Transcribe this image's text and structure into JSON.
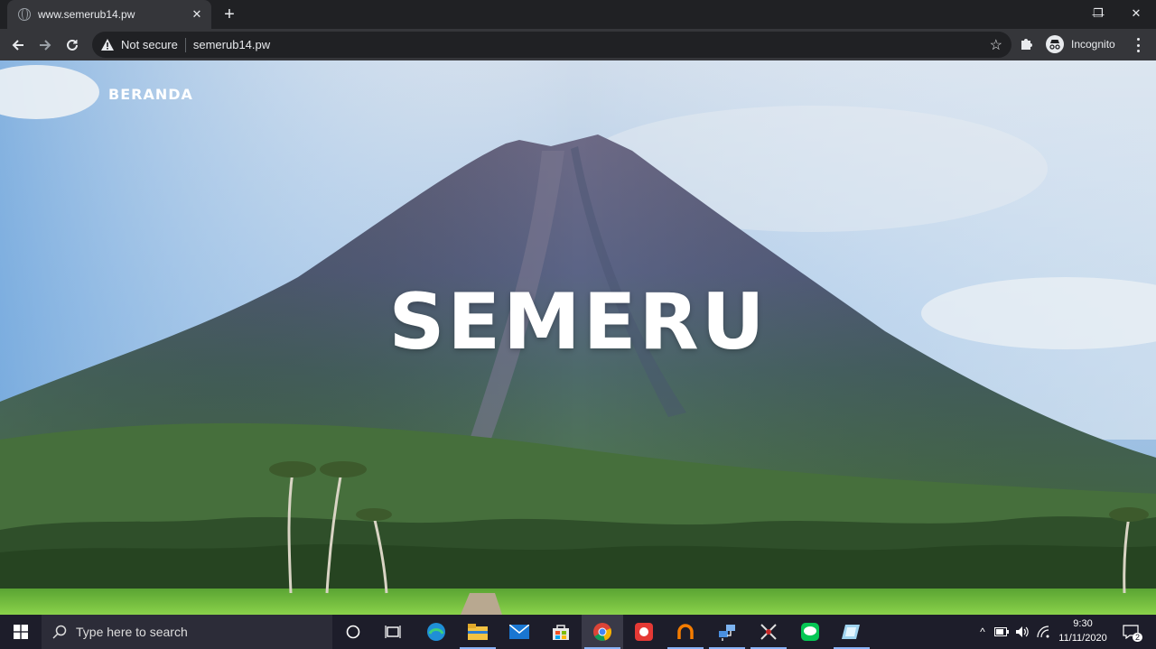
{
  "browser": {
    "tab_title": "www.semerub14.pw",
    "close_glyph": "✕",
    "new_tab_glyph": "+",
    "security_label": "Not secure",
    "url": "semerub14.pw",
    "profile_label": "Incognito",
    "window_controls": {
      "minimize": "—",
      "maximize": "❐",
      "close": "✕"
    }
  },
  "page": {
    "nav_link": "BERANDA",
    "hero_title": "SEMERU"
  },
  "taskbar": {
    "search_placeholder": "Type here to search",
    "time": "9:30",
    "date": "11/11/2020",
    "notification_count": "2",
    "apps": [
      "task-view",
      "edge",
      "file-explorer",
      "mail",
      "store",
      "chrome",
      "app-red",
      "app-orange",
      "network-app",
      "app-x",
      "line",
      "app-blue"
    ]
  },
  "colors": {
    "sky": "#9ec4e6",
    "mountain": "#5d6a8e",
    "forest": "#3f6a3a",
    "field": "#7ec43c",
    "chrome_dark": "#202124",
    "chrome_toolbar": "#35363a"
  }
}
